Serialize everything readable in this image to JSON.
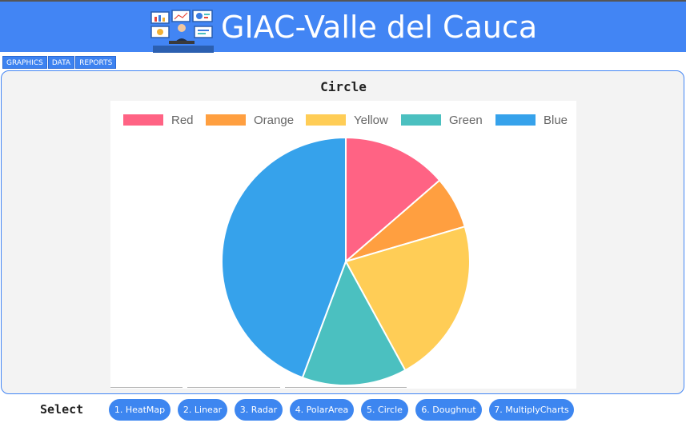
{
  "app": {
    "title": "GIAC-Valle del Cauca"
  },
  "nav": {
    "tabs": [
      "GRAPHICS",
      "DATA",
      "REPORTS"
    ]
  },
  "chart_title": "Circle",
  "chart_data": {
    "type": "pie",
    "labels": [
      "Red",
      "Orange",
      "Yellow",
      "Green",
      "Blue"
    ],
    "values": [
      12,
      6,
      19,
      12,
      39
    ],
    "colors": [
      "#ff6384",
      "#ff9f40",
      "#ffcd56",
      "#4bc0c0",
      "#36a2eb"
    ],
    "legend": "top"
  },
  "footer": {
    "select_label": "Select",
    "buttons": [
      "1. HeatMap",
      "2. Linear",
      "3. Radar",
      "4. PolarArea",
      "5. Circle",
      "6. Doughnut",
      "7. MultiplyCharts"
    ]
  }
}
